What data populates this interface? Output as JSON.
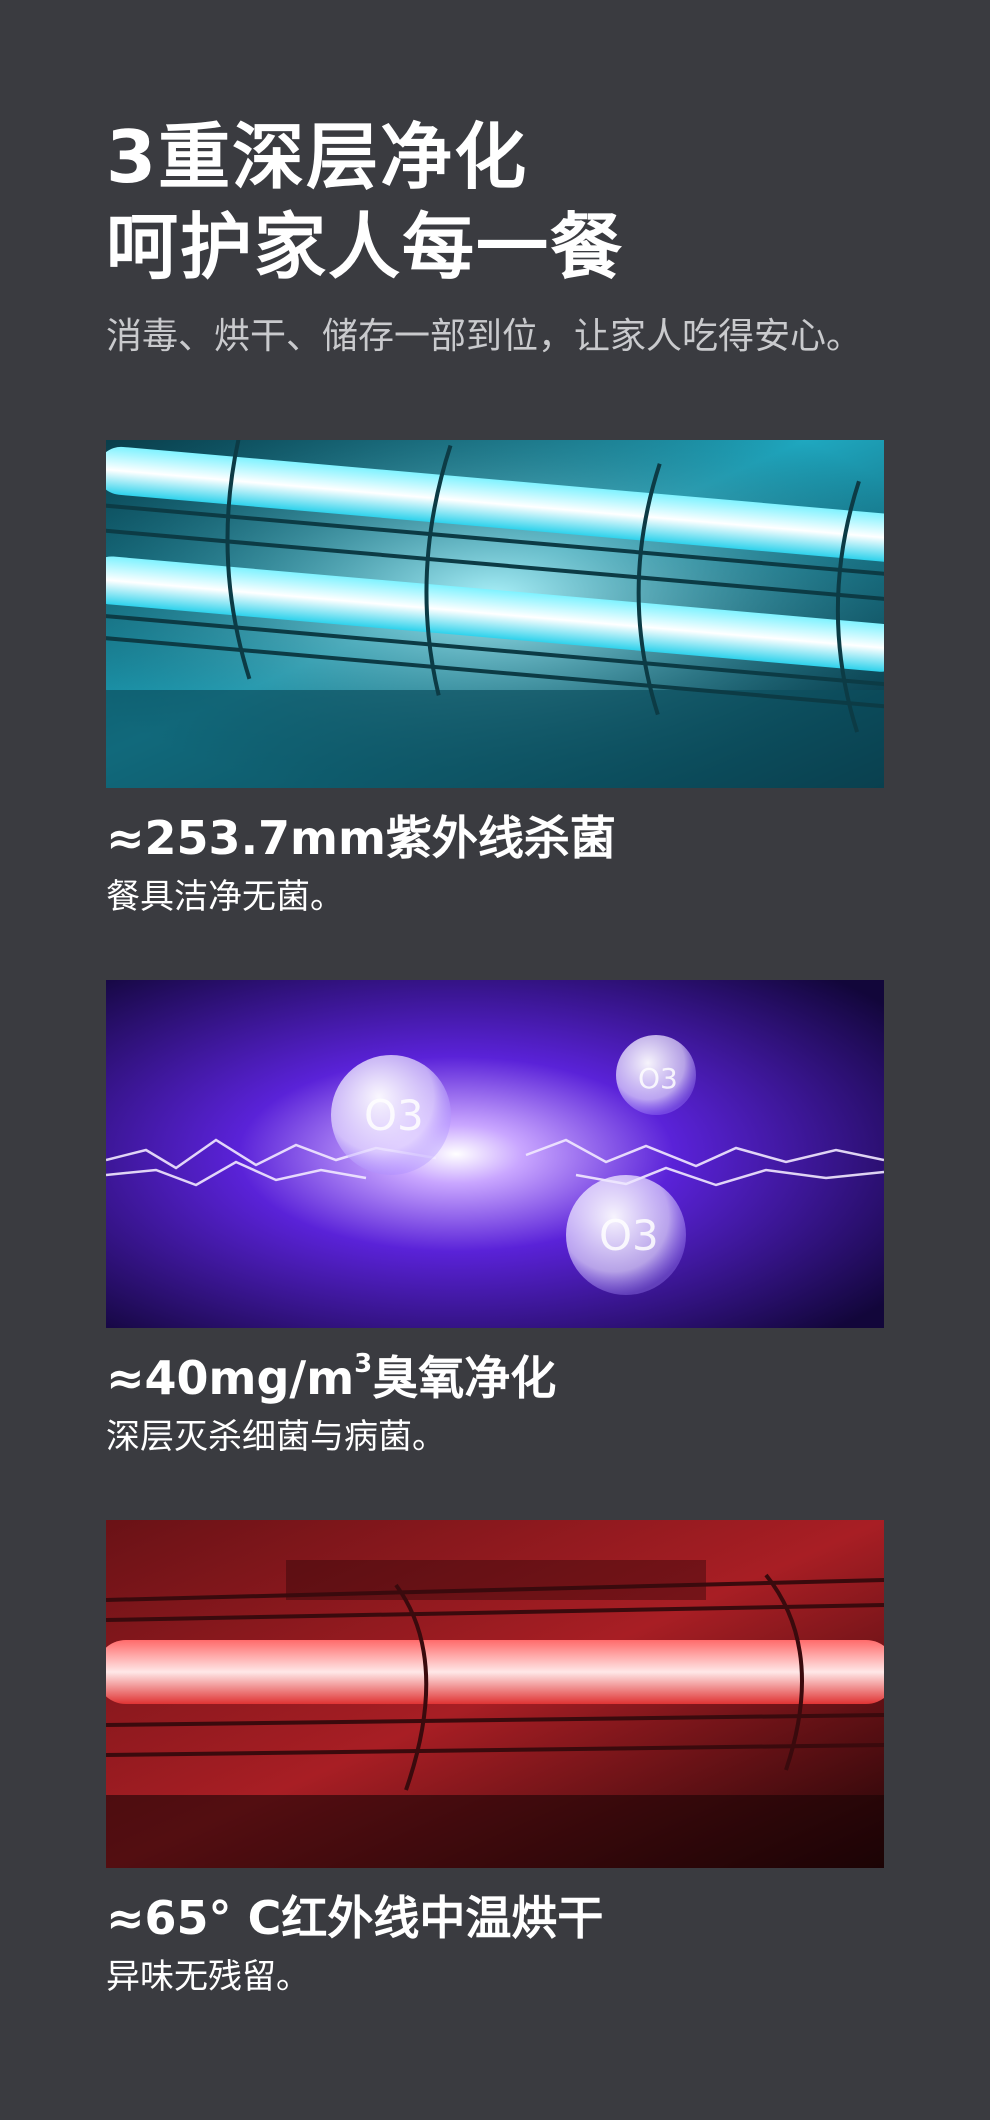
{
  "hero": {
    "title_line1": "3重深层净化",
    "title_line2": "呵护家人每一餐",
    "subtitle": "消毒、烘干、储存一部到位，让家人吃得安心。"
  },
  "features": [
    {
      "title": "≈253.7mm紫外线杀菌",
      "description": "餐具洁净无菌。",
      "accent_color": "#3fe7ff"
    },
    {
      "title_prefix": "≈40mg/m",
      "title_sup": "3",
      "title_suffix": "臭氧净化",
      "description": "深层灭杀细菌与病菌。",
      "accent_color": "#6a2cff",
      "bubble_label": "O3"
    },
    {
      "title": "≈65°  C红外线中温烘干",
      "description": "异味无残留。",
      "accent_color": "#ff4a4a"
    }
  ]
}
